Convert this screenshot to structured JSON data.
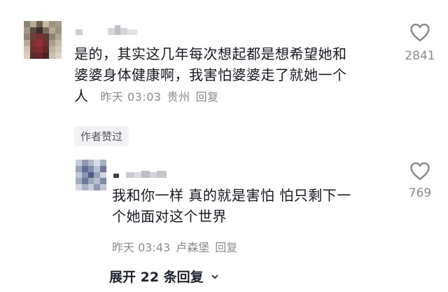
{
  "comments": [
    {
      "text_lines": [
        "是的，其实这几年每次想起都是想希望她和",
        "婆婆身体健康啊，我害怕婆婆走了就她一个",
        "人"
      ],
      "time": "昨天 03:03",
      "location": "贵州",
      "reply_label": "回复",
      "likes": "2841",
      "badge": "作者赞过"
    },
    {
      "text_lines": [
        "我和你一样 真的就是害怕 怕只剩下一",
        "个她面对这个世界"
      ],
      "time": "昨天 03:43",
      "location": "卢森堡",
      "reply_label": "回复",
      "likes": "769"
    }
  ],
  "expand_replies": "展开 22 条回复",
  "icons": {
    "like": "heart-outline-icon",
    "expand": "chevron-down-icon"
  }
}
